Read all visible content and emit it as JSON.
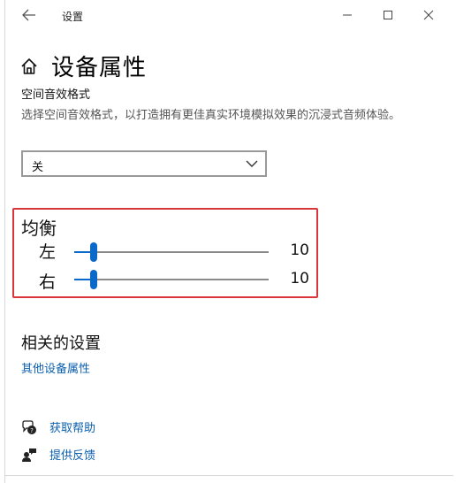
{
  "window": {
    "title": "设置"
  },
  "page": {
    "title": "设备属性"
  },
  "spatial_audio": {
    "label": "空间音效格式",
    "description": "选择空间音效格式，以打造拥有更佳真实环境模拟效果的沉浸式音频体验。",
    "dropdown_value": "关"
  },
  "balance": {
    "title": "均衡",
    "left": {
      "label": "左",
      "value": "10",
      "level": 0.1
    },
    "right": {
      "label": "右",
      "value": "10",
      "level": 0.1
    }
  },
  "related": {
    "title": "相关的设置",
    "link": "其他设备属性"
  },
  "help": {
    "get_help": "获取帮助",
    "feedback": "提供反馈"
  },
  "colors": {
    "accent": "#0a68c9",
    "link": "#0b5fae",
    "highlight_border": "#d9363b"
  }
}
